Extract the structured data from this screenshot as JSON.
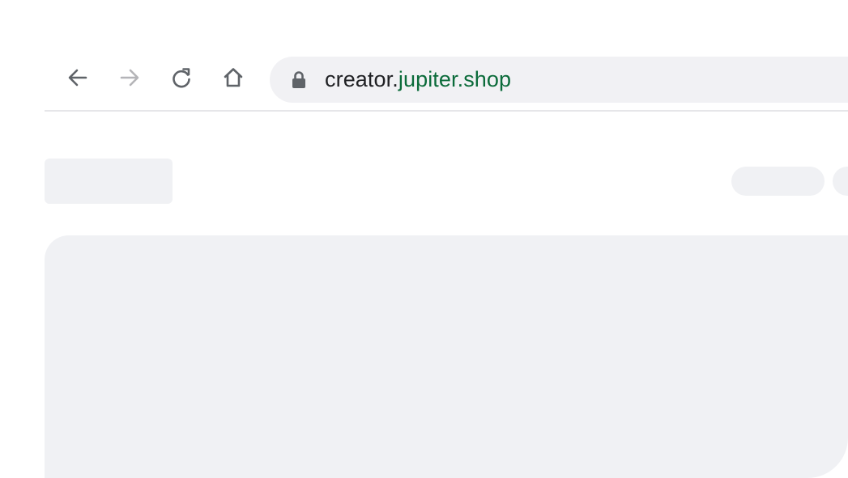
{
  "browser": {
    "url_prefix": "creator.",
    "url_host": "jupiter.shop",
    "colors": {
      "host": "#0b6b3a",
      "text": "#202124",
      "icon": "#5f6368",
      "icon_disabled": "#b4b4b8",
      "omnibox_bg": "#f1f1f4",
      "skeleton": "#f0f1f4"
    },
    "icons": {
      "back": "arrow-left-icon",
      "forward": "arrow-right-icon",
      "reload": "reload-icon",
      "home": "home-icon",
      "secure": "lock-icon"
    }
  }
}
